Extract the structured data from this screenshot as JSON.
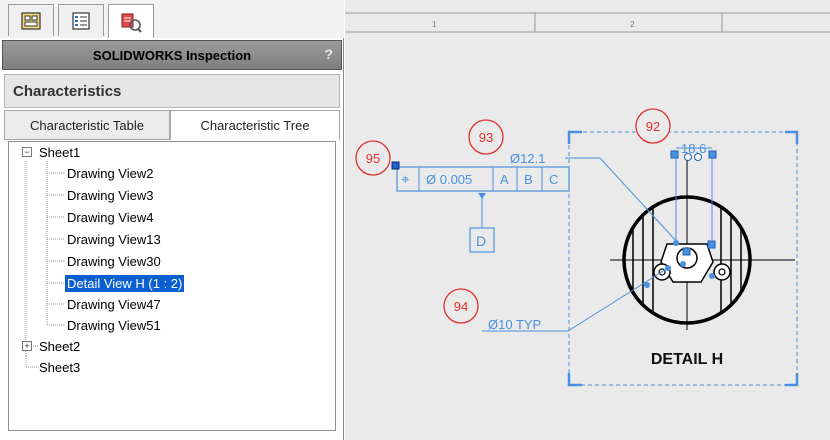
{
  "panel": {
    "title": "SOLIDWORKS Inspection",
    "help": "?",
    "section": "Characteristics",
    "tabs": [
      {
        "label": "Characteristic Table",
        "active": false
      },
      {
        "label": "Characteristic Tree",
        "active": true
      }
    ]
  },
  "toptabs": [
    {
      "icon": "property-manager-icon"
    },
    {
      "icon": "feature-tree-icon"
    },
    {
      "icon": "inspection-icon",
      "active": true
    }
  ],
  "tree": {
    "sheet1": "Sheet1",
    "views": [
      "Drawing View2",
      "Drawing View3",
      "Drawing View4",
      "Drawing View13",
      "Drawing View30",
      "Detail View H (1 : 2)",
      "Drawing View47",
      "Drawing View51"
    ],
    "selected_index": 5,
    "sheet2": "Sheet2",
    "sheet3": "Sheet3"
  },
  "drawing": {
    "zones": [
      "1",
      "2"
    ],
    "balloons": [
      "95",
      "93",
      "92",
      "94"
    ],
    "fcf": {
      "symbol": "⌖",
      "tolerance": "Ø 0.005",
      "datums": [
        "A",
        "B",
        "C"
      ]
    },
    "datum_d": "D",
    "dim_12_1": "Ø12.1",
    "dim_18_6": "18.6",
    "dim_10_typ": "Ø10 TYP",
    "detail_label": "DETAIL H"
  },
  "colors": {
    "balloon": "#e03030",
    "dimension": "#4a90e0",
    "selected": "#0a5fd1"
  }
}
